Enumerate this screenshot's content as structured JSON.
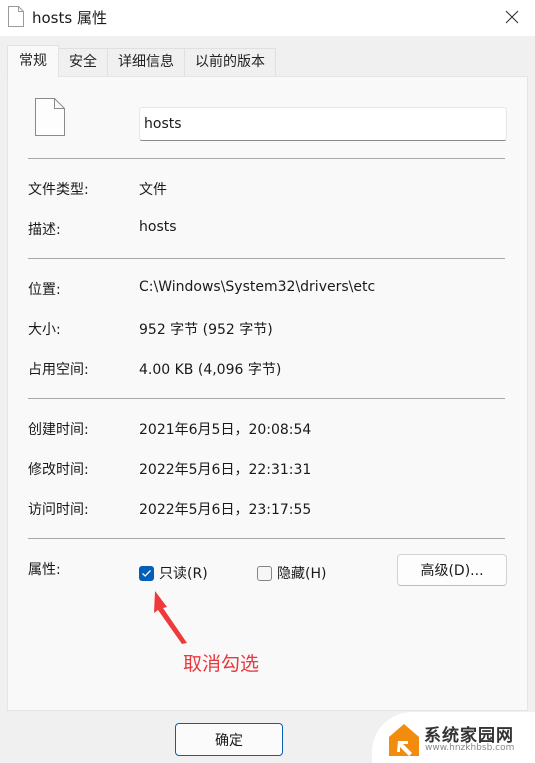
{
  "window": {
    "title": "hosts 属性",
    "close_icon": "close-icon",
    "title_icon": "file-icon"
  },
  "tabs": [
    {
      "label": "常规",
      "active": true
    },
    {
      "label": "安全",
      "active": false
    },
    {
      "label": "详细信息",
      "active": false
    },
    {
      "label": "以前的版本",
      "active": false
    }
  ],
  "general": {
    "file_name": "hosts",
    "file_type_label": "文件类型:",
    "file_type_value": "文件",
    "description_label": "描述:",
    "description_value": "hosts",
    "location_label": "位置:",
    "location_value": "C:\\Windows\\System32\\drivers\\etc",
    "size_label": "大小:",
    "size_value": "952 字节 (952 字节)",
    "size_on_disk_label": "占用空间:",
    "size_on_disk_value": "4.00 KB (4,096 字节)",
    "created_label": "创建时间:",
    "created_value": "2021年6月5日，20:08:54",
    "modified_label": "修改时间:",
    "modified_value": "2022年5月6日，22:31:31",
    "accessed_label": "访问时间:",
    "accessed_value": "2022年5月6日，23:17:55",
    "attributes_label": "属性:",
    "readonly_label": "只读(R)",
    "readonly_checked": true,
    "hidden_label": "隐藏(H)",
    "hidden_checked": false,
    "advanced_button": "高级(D)..."
  },
  "annotation": {
    "text": "取消勾选",
    "color": "#e8393f"
  },
  "footer": {
    "ok_button": "确定"
  },
  "watermark": {
    "title": "系统家园网",
    "url": "www.hnzkhbsb.com",
    "logo_color": "#f28c0f"
  },
  "colors": {
    "accent": "#005fb8",
    "panel_bg": "#f9f9f9",
    "window_bg": "#f0f0f0"
  }
}
